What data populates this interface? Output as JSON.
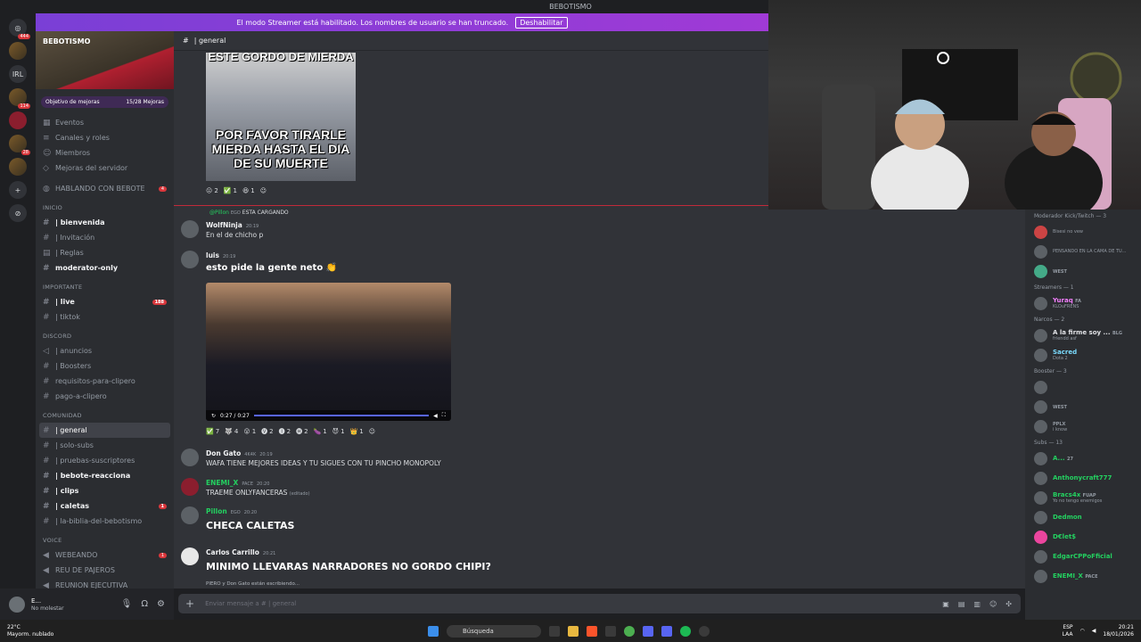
{
  "window": {
    "title": "BEBOTISMO"
  },
  "streamer_banner": {
    "text": "El modo Streamer está habilitado. Los nombres de usuario se han truncado.",
    "button": "Deshabilitar"
  },
  "guilds": [
    {
      "badge": "444"
    },
    {
      "badge": ""
    },
    {
      "label": "IRL"
    },
    {
      "badge": "114"
    },
    {
      "badge": ""
    },
    {
      "badge": "28"
    },
    {
      "badge": ""
    }
  ],
  "server": {
    "name": "BEBOTISMO",
    "boost_goal": "Objetivo de mejoras",
    "boost_count": "15/28 Mejoras",
    "menu": [
      "Eventos",
      "Canales y roles",
      "Miembros",
      "Mejoras del servidor"
    ],
    "special_channel": {
      "label": "HABLANDO CON BEBOTE",
      "count": "4"
    }
  },
  "channel_groups": [
    {
      "category": "INICIO",
      "channels": [
        {
          "name": "| bienvenida",
          "bold": true
        },
        {
          "name": "| Invitación"
        },
        {
          "name": "| Reglas"
        },
        {
          "name": "moderator-only",
          "bold": true
        }
      ]
    },
    {
      "category": "IMPORTANTE",
      "channels": [
        {
          "name": "| live",
          "bold": true,
          "count": "188"
        },
        {
          "name": "| tiktok"
        }
      ]
    },
    {
      "category": "DISCORD",
      "channels": [
        {
          "name": "| anuncios"
        },
        {
          "name": "| Boosters"
        },
        {
          "name": "requisitos-para-clipero"
        },
        {
          "name": "pago-a-clipero"
        }
      ]
    },
    {
      "category": "COMUNIDAD",
      "channels": [
        {
          "name": "| general",
          "selected": true
        },
        {
          "name": "| solo-subs"
        },
        {
          "name": "| pruebas-suscriptores"
        },
        {
          "name": "| bebote-reacciona",
          "bold": true
        },
        {
          "name": "| clips",
          "bold": true
        },
        {
          "name": "| caletas",
          "bold": true,
          "count": "1"
        },
        {
          "name": "| la-biblia-del-bebotismo"
        }
      ]
    },
    {
      "category": "VOICE",
      "channels": [
        {
          "name": "WEBEANDO",
          "count": "1"
        },
        {
          "name": "REU DE PAJEROS"
        },
        {
          "name": "REUNION EJECUTIVA"
        }
      ]
    }
  ],
  "user_panel": {
    "name": "E...",
    "status": "No molestar"
  },
  "chat": {
    "channel": "| general",
    "meme": {
      "top": "ESTE GORDO DE MIERDA",
      "bottom": "POR FAVOR TIRARLE MIERDA HASTA EL DIA DE SU MUERTE"
    },
    "meme_reactions": [
      "2",
      "1",
      "1"
    ],
    "reply": {
      "author": "@Pillon",
      "tag": "EGO",
      "text": "ESTA CARGANDO"
    },
    "messages": [
      {
        "author": "WolfNinja",
        "time": "20:19",
        "text": "En el de chicho p"
      },
      {
        "author": "luis",
        "time": "20:19",
        "text": "esto pide la gente neto"
      },
      {
        "author": "Don Gato",
        "time": "20:19",
        "tag": "4K4K",
        "text": "WAFA TIENE MEJORES IDEAS Y TU SIGUES CON TU PINCHO MONOPOLY"
      },
      {
        "author": "ENEMI_X",
        "time": "20:20",
        "tag": "PACE",
        "text": "TRAEME ONLYFANCERAS",
        "edited": "(editado)"
      },
      {
        "author": "Pillon",
        "time": "20:20",
        "tag": "EGO",
        "text": "CHECA CALETAS"
      },
      {
        "author": "Carlos Carrillo",
        "time": "20:21",
        "text": "MINIMO LLEVARAS NARRADORES NO GORDO CHIPI?"
      }
    ],
    "video": {
      "time": "0:27 / 0:27"
    },
    "video_reactions": [
      "7",
      "4",
      "1",
      "2",
      "2",
      "2",
      "1",
      "1",
      "1"
    ],
    "typing": "PIERO y Don Gato están escribiendo...",
    "input_placeholder": "Enviar mensaje a #",
    "input_channel": "| general"
  },
  "members": {
    "groups": [
      {
        "title": "Moderador Kick/Twitch — 3",
        "items": [
          {
            "name": "",
            "status": "Bisesi no vew"
          },
          {
            "name": "",
            "status": "PENSANDO EN LA CAMA DE TU..."
          },
          {
            "name": "",
            "tag": "WEST"
          }
        ]
      },
      {
        "title": "Streamers — 1",
        "items": [
          {
            "name": "Yuraq",
            "tag": "FA",
            "status": "KLOuFRENS"
          }
        ]
      },
      {
        "title": "Narcos — 2",
        "items": [
          {
            "name": "A la firme soy ...",
            "tag": "BLG",
            "status": "friendd asf"
          },
          {
            "name": "Sacred",
            "status": "Dota 2"
          }
        ]
      },
      {
        "title": "Booster — 3",
        "items": [
          {
            "name": ""
          },
          {
            "name": "",
            "tag": "WEST"
          },
          {
            "name": "",
            "tag": "PPLX",
            "status": "i know"
          }
        ]
      },
      {
        "title": "Subs — 13",
        "items": [
          {
            "name": "A...",
            "tag": "27"
          },
          {
            "name": "Anthonycraft777"
          },
          {
            "name": "Bracs4x",
            "tag": "FUAP",
            "status": "Yo no tengo enemigos"
          },
          {
            "name": "Dedmon"
          },
          {
            "name": "D€let$"
          },
          {
            "name": "EdgarCPPoFficial"
          },
          {
            "name": "ENEMI_X",
            "tag": "PACE"
          }
        ]
      }
    ]
  },
  "taskbar": {
    "weather_temp": "22°C",
    "weather_text": "Mayorm. nublado",
    "search": "Búsqueda",
    "lang": "ESP",
    "lang_sub": "LAA",
    "time": "20:21",
    "date": "18/01/2026"
  },
  "colors": {
    "accent": "#5865f2",
    "banner": "#a03ad6",
    "green_name": "#23d160",
    "red_badge": "#da373c"
  }
}
